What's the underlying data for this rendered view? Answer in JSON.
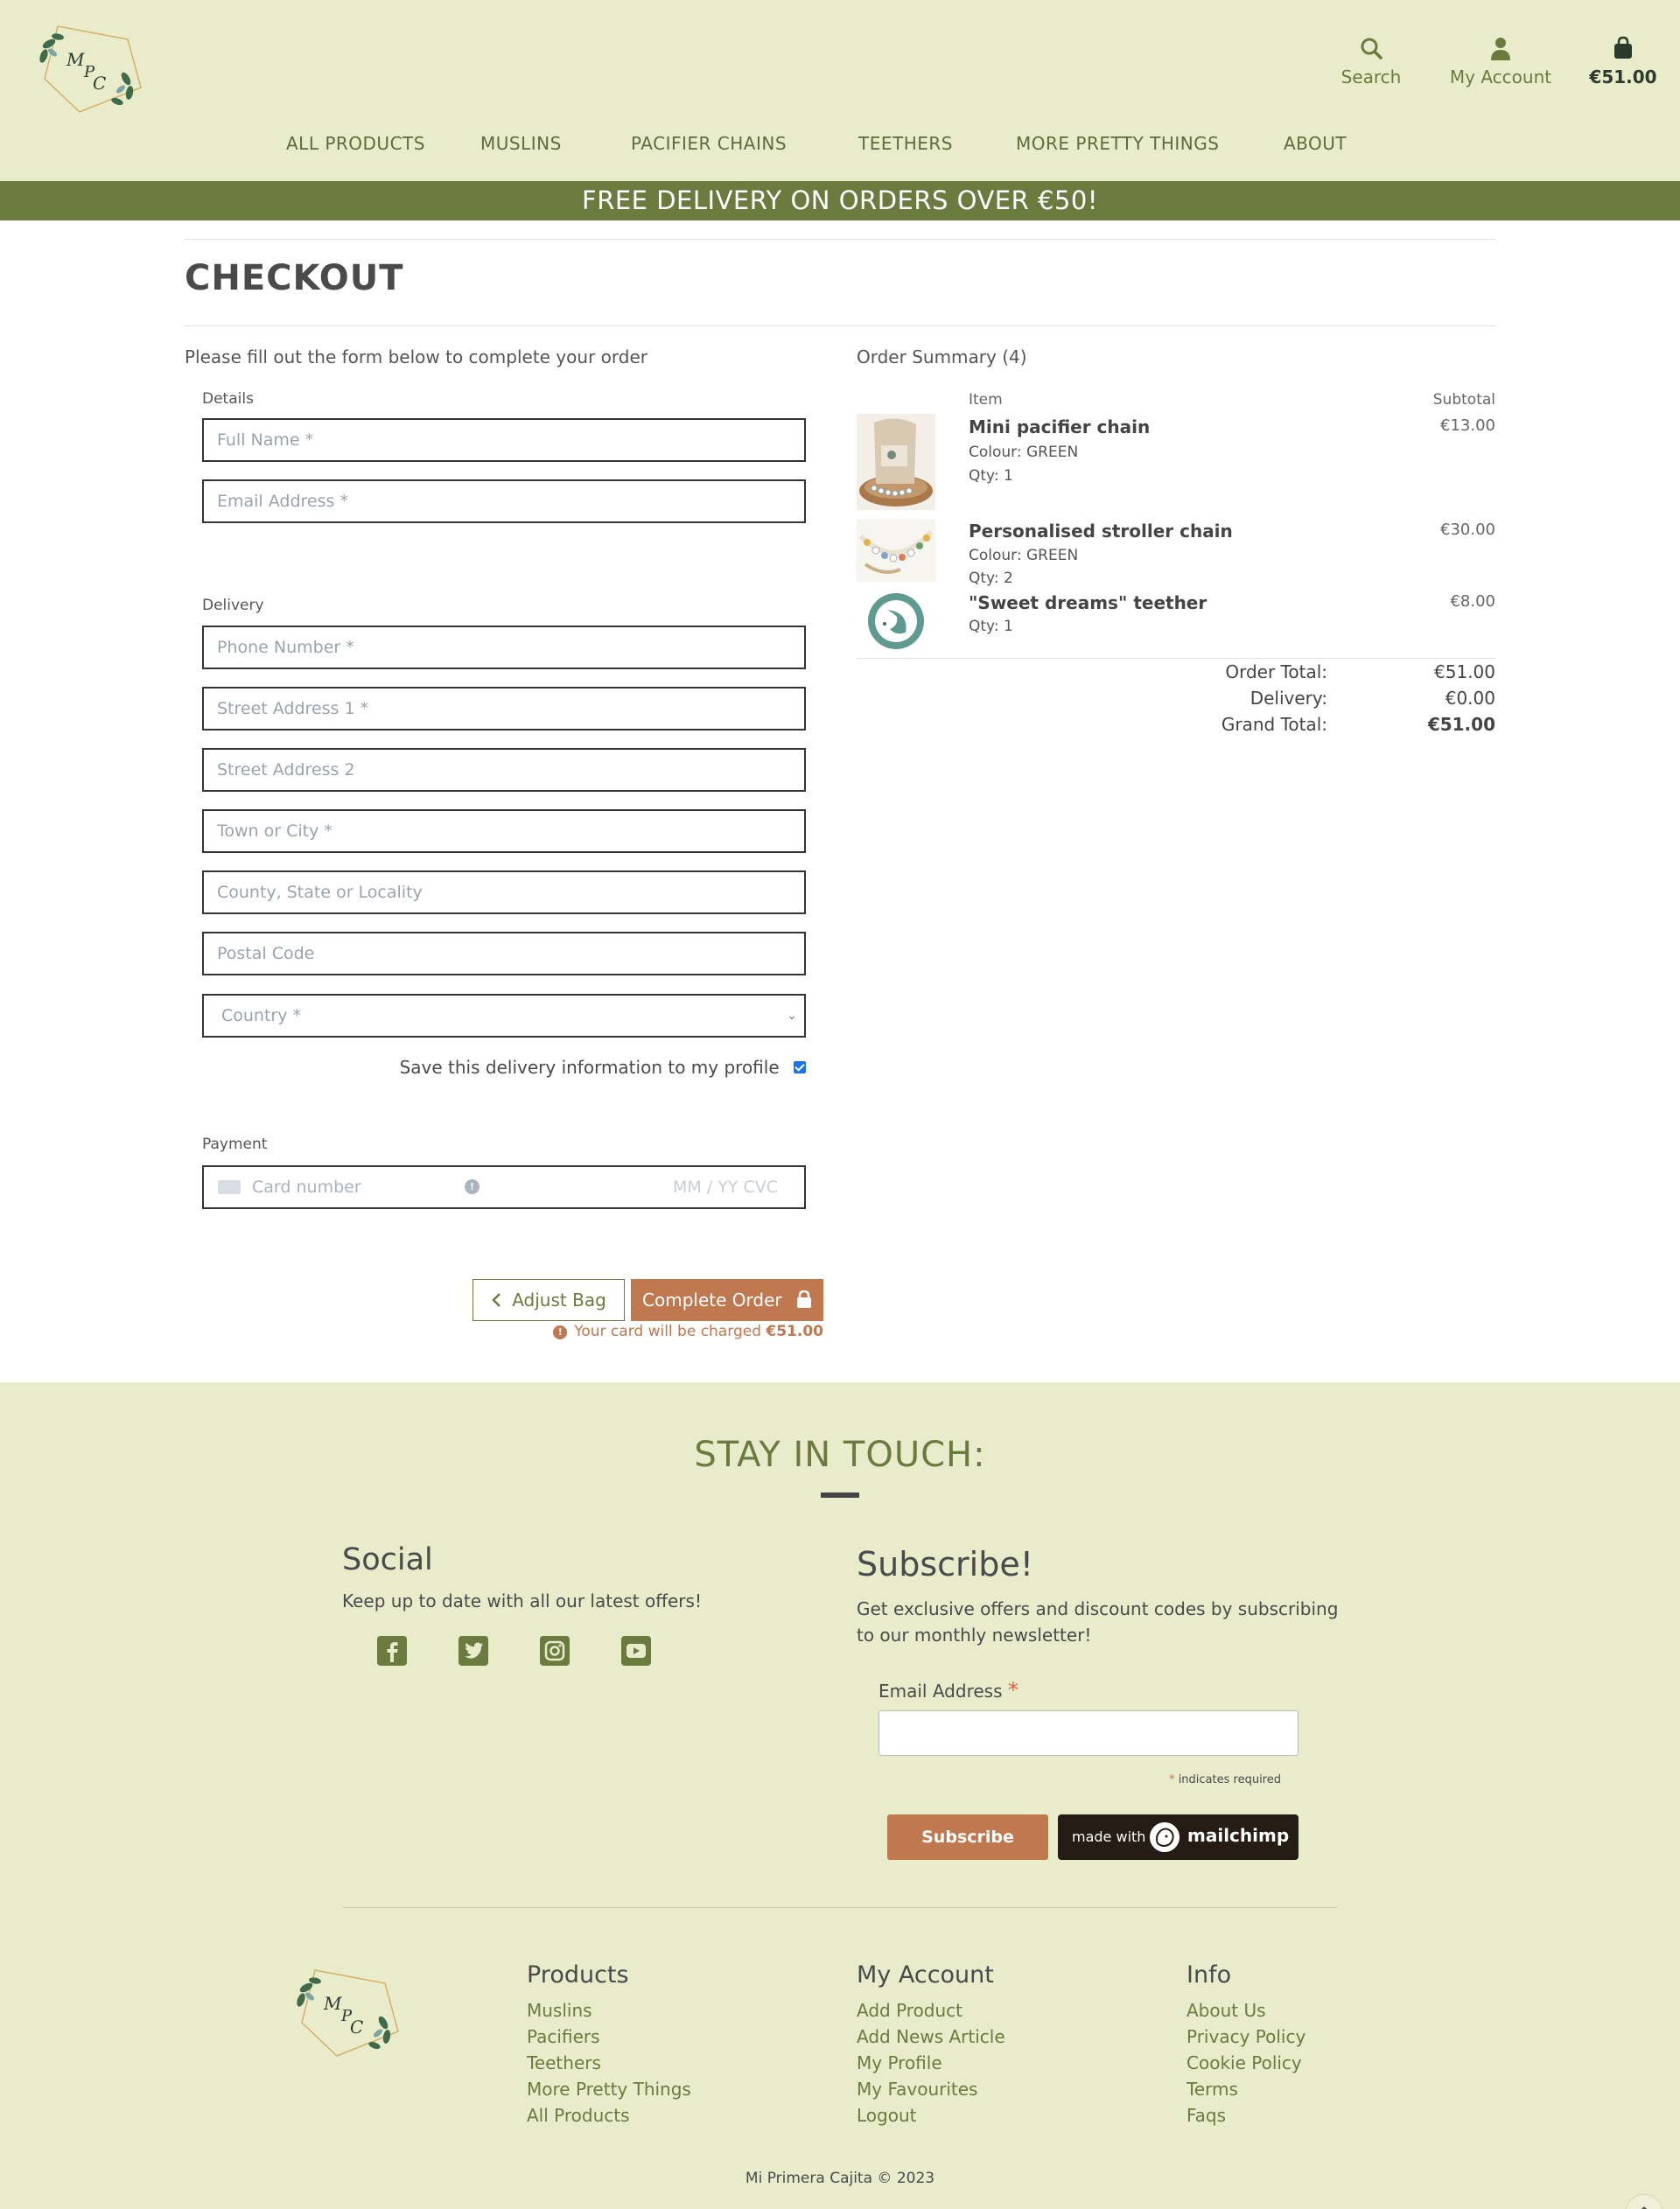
{
  "header": {
    "search_label": "Search",
    "account_label": "My Account",
    "bag_total": "€51.00",
    "logo_text": "MPC"
  },
  "nav": [
    "ALL PRODUCTS",
    "MUSLINS",
    "PACIFIER CHAINS",
    "TEETHERS",
    "MORE PRETTY THINGS",
    "ABOUT"
  ],
  "banner": "FREE DELIVERY ON ORDERS OVER €50!",
  "checkout": {
    "title": "CHECKOUT",
    "intro": "Please fill out the form below to complete your order",
    "details_label": "Details",
    "delivery_label": "Delivery",
    "payment_label": "Payment",
    "fields": {
      "full_name": "Full Name *",
      "email": "Email Address *",
      "phone": "Phone Number *",
      "street1": "Street Address 1 *",
      "street2": "Street Address 2",
      "town": "Town or City *",
      "county": "County, State or Locality",
      "postcode": "Postal Code",
      "country": "Country *"
    },
    "save_info": "Save this delivery information to my profile",
    "card_number": "Card number",
    "card_exp_cvc": "MM / YY  CVC",
    "adjust_bag": "Adjust Bag",
    "complete_order": "Complete Order",
    "charge_note": "Your card will be charged",
    "charge_amount": "€51.00"
  },
  "summary": {
    "title": "Order Summary (4)",
    "item_header": "Item",
    "subtotal_header": "Subtotal",
    "items": [
      {
        "name": "Mini pacifier chain",
        "colour": "Colour: GREEN",
        "qty": "Qty: 1",
        "price": "€13.00"
      },
      {
        "name": "Personalised stroller chain",
        "colour": "Colour: GREEN",
        "qty": "Qty: 2",
        "price": "€30.00"
      },
      {
        "name": "\"Sweet dreams\" teether",
        "colour": "",
        "qty": "Qty: 1",
        "price": "€8.00"
      }
    ],
    "order_total_label": "Order Total:",
    "order_total": "€51.00",
    "delivery_label": "Delivery:",
    "delivery": "€0.00",
    "grand_total_label": "Grand Total:",
    "grand_total": "€51.00"
  },
  "footer": {
    "stay": "STAY IN TOUCH:",
    "social_title": "Social",
    "social_text": "Keep up to date with all our latest offers!",
    "subscribe_title": "Subscribe!",
    "subscribe_text": "Get exclusive offers and discount codes by subscribing to our monthly newsletter!",
    "email_label": "Email Address",
    "required_note": "indicates required",
    "subscribe_button": "Subscribe",
    "mc_made": "made with",
    "mc_brand": "mailchimp",
    "products_title": "Products",
    "products": [
      "Muslins",
      "Pacifiers",
      "Teethers",
      "More Pretty Things",
      "All Products"
    ],
    "account_title": "My Account",
    "account": [
      "Add Product",
      "Add News Article",
      "My Profile",
      "My Favourites",
      "Logout"
    ],
    "info_title": "Info",
    "info": [
      "About Us",
      "Privacy Policy",
      "Cookie Policy",
      "Terms",
      "Faqs"
    ],
    "copyright": "Mi Primera Cajita © 2023"
  },
  "colors": {
    "header_bg": "#e8ecca",
    "olive": "#6b7a3f",
    "accent": "#c0784f"
  },
  "icons": [
    "search-icon",
    "user-icon",
    "shopping-bag-icon",
    "chevron-left-icon",
    "lock-icon",
    "info-icon",
    "facebook-icon",
    "twitter-icon",
    "instagram-icon",
    "youtube-icon",
    "arrow-up-icon"
  ]
}
